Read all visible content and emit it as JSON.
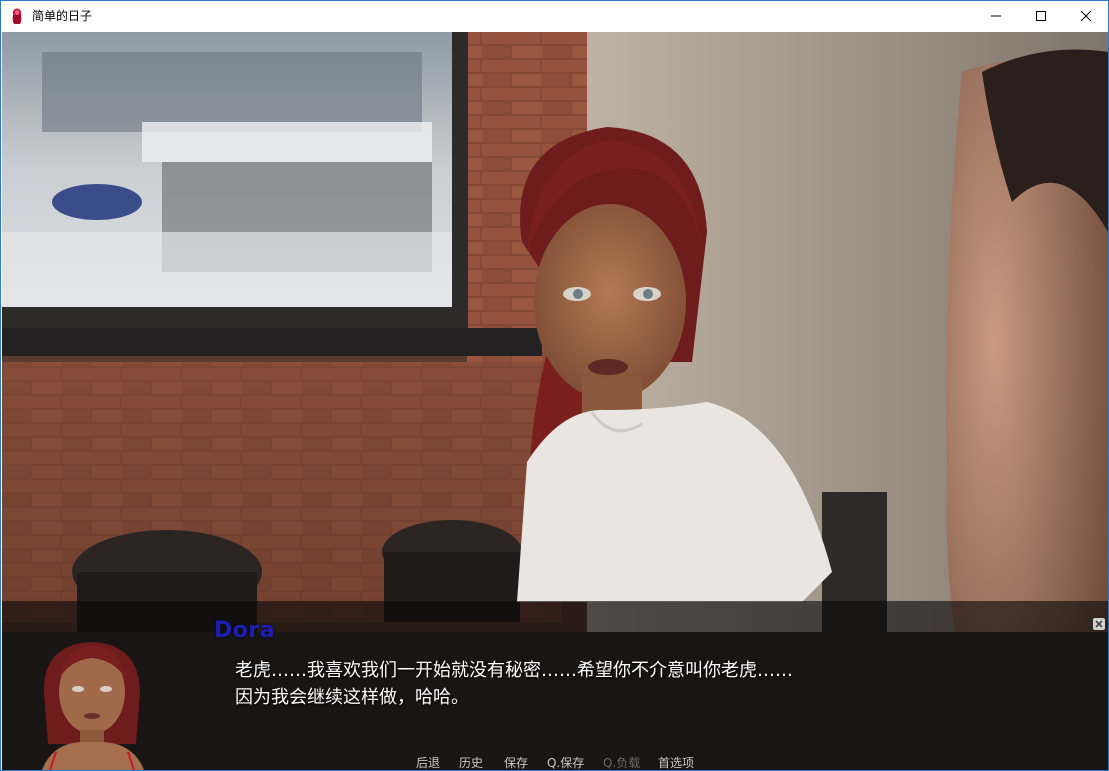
{
  "window": {
    "title": "简单的日子"
  },
  "dialogue": {
    "speaker": "Dora",
    "speaker_color": "#1d1fb0",
    "lines": [
      "老虎……我喜欢我们一开始就没有秘密……希望你不介意叫你老虎……",
      "因为我会继续这样做，哈哈。"
    ]
  },
  "quick_menu": {
    "items": [
      {
        "label": "后退",
        "enabled": true
      },
      {
        "label": "历史",
        "enabled": true
      },
      {
        "label": "保存",
        "enabled": true
      },
      {
        "label": "Q.保存",
        "enabled": true
      },
      {
        "label": "Q.负载",
        "enabled": false
      },
      {
        "label": "首选项",
        "enabled": true
      }
    ]
  },
  "icons": {
    "app": "app-icon",
    "minimize": "minimize-icon",
    "maximize": "maximize-icon",
    "close": "close-icon",
    "skip_close": "close-small-icon"
  }
}
